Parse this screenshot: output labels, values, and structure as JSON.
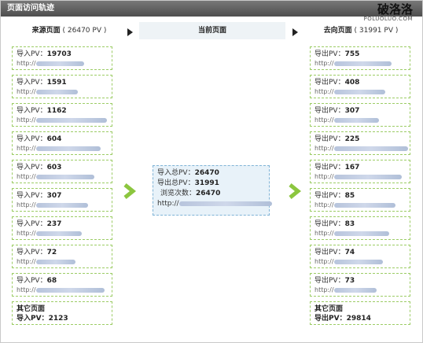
{
  "header": {
    "title": "页面访问轨迹"
  },
  "watermark": {
    "cn": "破洛洛",
    "en": "POLUOLUO.COM"
  },
  "columns": {
    "left": {
      "label": "来源页面",
      "count": "( 26470  PV )"
    },
    "center": {
      "label": "当前页面"
    },
    "right": {
      "label": "去向页面",
      "count": "( 31991  PV )"
    }
  },
  "sources": [
    {
      "label": "导入PV：",
      "value": "19703",
      "url": "http://"
    },
    {
      "label": "导入PV：",
      "value": "1591",
      "url": "http://"
    },
    {
      "label": "导入PV：",
      "value": "1162",
      "url": "http://"
    },
    {
      "label": "导入PV：",
      "value": "604",
      "url": "http://"
    },
    {
      "label": "导入PV：",
      "value": "603",
      "url": "http://"
    },
    {
      "label": "导入PV：",
      "value": "307",
      "url": "http://"
    },
    {
      "label": "导入PV：",
      "value": "237",
      "url": "http://"
    },
    {
      "label": "导入PV：",
      "value": "72",
      "url": "http://"
    },
    {
      "label": "导入PV：",
      "value": "68",
      "url": "http://"
    }
  ],
  "sources_other": {
    "title": "其它页面",
    "label": "导入PV：",
    "value": "2123"
  },
  "destinations": [
    {
      "label": "导出PV：",
      "value": "755",
      "url": "http://"
    },
    {
      "label": "导出PV：",
      "value": "408",
      "url": "http://"
    },
    {
      "label": "导出PV：",
      "value": "307",
      "url": "http://"
    },
    {
      "label": "导出PV：",
      "value": "225",
      "url": "http://"
    },
    {
      "label": "导出PV：",
      "value": "167",
      "url": "http://"
    },
    {
      "label": "导出PV：",
      "value": "85",
      "url": "http://"
    },
    {
      "label": "导出PV：",
      "value": "83",
      "url": "http://"
    },
    {
      "label": "导出PV：",
      "value": "74",
      "url": "http://"
    },
    {
      "label": "导出PV：",
      "value": "73",
      "url": "http://"
    }
  ],
  "destinations_other": {
    "title": "其它页面",
    "label": "导出PV：",
    "value": "29814"
  },
  "current": {
    "in_label": "导入总PV：",
    "in_value": "26470",
    "out_label": "导出总PV：",
    "out_value": "31991",
    "views_label": "浏览次数：",
    "views_value": "26470",
    "url": "http://"
  },
  "colors": {
    "title_bar": "#5e5e5e",
    "box_border": "#9ccc65",
    "center_fill": "#e8f2f9",
    "arrow": "#8cc63f",
    "url_blur": "#b7c4dc"
  }
}
